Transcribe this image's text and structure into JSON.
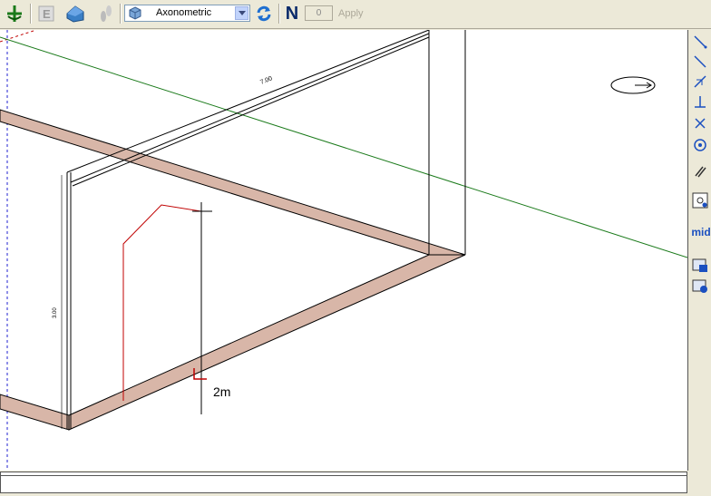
{
  "toolbar": {
    "view_mode": "Axonometric",
    "north_label": "N",
    "angle_value": "0",
    "apply_label": "Apply"
  },
  "drawing": {
    "dim_top": "7.00",
    "dim_side": "3.00",
    "cursor_label": "2m"
  },
  "right_toolbar": {
    "mid_label": "mid"
  },
  "colors": {
    "slab_fill": "#d8b6a8",
    "axis_green": "#1a7a1a",
    "guide_red": "#c00000",
    "axis_blue": "#2020d0"
  }
}
